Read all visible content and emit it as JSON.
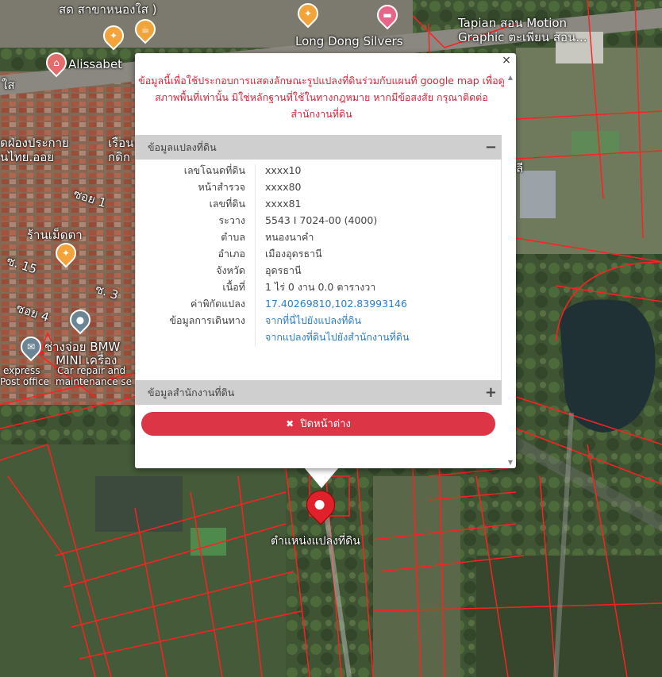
{
  "map": {
    "labels": {
      "top_street": "สด สาขาหนองใส )",
      "alissabet": "Alissabet",
      "long_dong": "Long Dong Silvers",
      "tapian_1": "Tapian สอน Motion",
      "tapian_2": "Graphic ตะเพียน สอน...",
      "sai": "ใส",
      "shop_1": "ดฝ่องประกาย",
      "shop_2": "นไทย.ออย",
      "ruean_1": "เรือน",
      "ruean_2": "กดิก",
      "soi_1": "ซอย 1",
      "ran_medta": "ร้านเม็ดตา",
      "so_15": "ซ. 15",
      "so_3": "ซ. 3",
      "soi_4": "ซอย 4",
      "bmw_1": "ช่างจ่อย BMW",
      "bmw_2": "MINI เครื่อง",
      "bmw_3": "Car repair and",
      "bmw_4": "maintenance se",
      "express_1": "express",
      "express_2": "Post office",
      "right_li": "ลี"
    },
    "pin_label": "ตำแหน่งแปลงที่ดิน",
    "parcel_color": "#ff2020"
  },
  "popup": {
    "close_symbol": "×",
    "notice": "ข้อมูลนี้เพื่อใช้ประกอบการแสดงลักษณะรูปแปลงที่ดินร่วมกับแผนที่ google map เพื่อดูสภาพพื้นที่เท่านั้น มิใช่หลักฐานที่ใช้ในทางกฎหมาย หากมีข้อสงสัย กรุณาติดต่อสำนักงานที่ดิน",
    "parcel_section": {
      "title": "ข้อมูลแปลงที่ดิน",
      "toggle": "−",
      "rows": [
        {
          "key": "เลขโฉนดที่ดิน",
          "value": "xxxx10"
        },
        {
          "key": "หน้าสำรวจ",
          "value": "xxxx80"
        },
        {
          "key": "เลขที่ดิน",
          "value": "xxxx81"
        },
        {
          "key": "ระวาง",
          "value": "5543 I 7024-00 (4000)"
        },
        {
          "key": "ตำบล",
          "value": "หนองนาคำ"
        },
        {
          "key": "อำเภอ",
          "value": "เมืองอุดรธานี"
        },
        {
          "key": "จังหวัด",
          "value": "อุดรธานี"
        },
        {
          "key": "เนื้อที่",
          "value": "1 ไร่ 0 งาน 0.0 ตารางวา"
        },
        {
          "key": "ค่าพิกัดแปลง",
          "value": "17.40269810,102.83993146"
        },
        {
          "key": "ข้อมูลการเดินทาง",
          "value": "จากที่นี่ไปยังแปลงที่ดิน"
        }
      ],
      "extra_link": "จากแปลงที่ดินไปยังสำนักงานที่ดิน"
    },
    "office_section": {
      "title": "ข้อมูลสำนักงานที่ดิน",
      "toggle": "+"
    },
    "close_button": {
      "icon": "✖",
      "label": "ปิดหน้าต่าง"
    },
    "accent_color": "#dc3545"
  }
}
